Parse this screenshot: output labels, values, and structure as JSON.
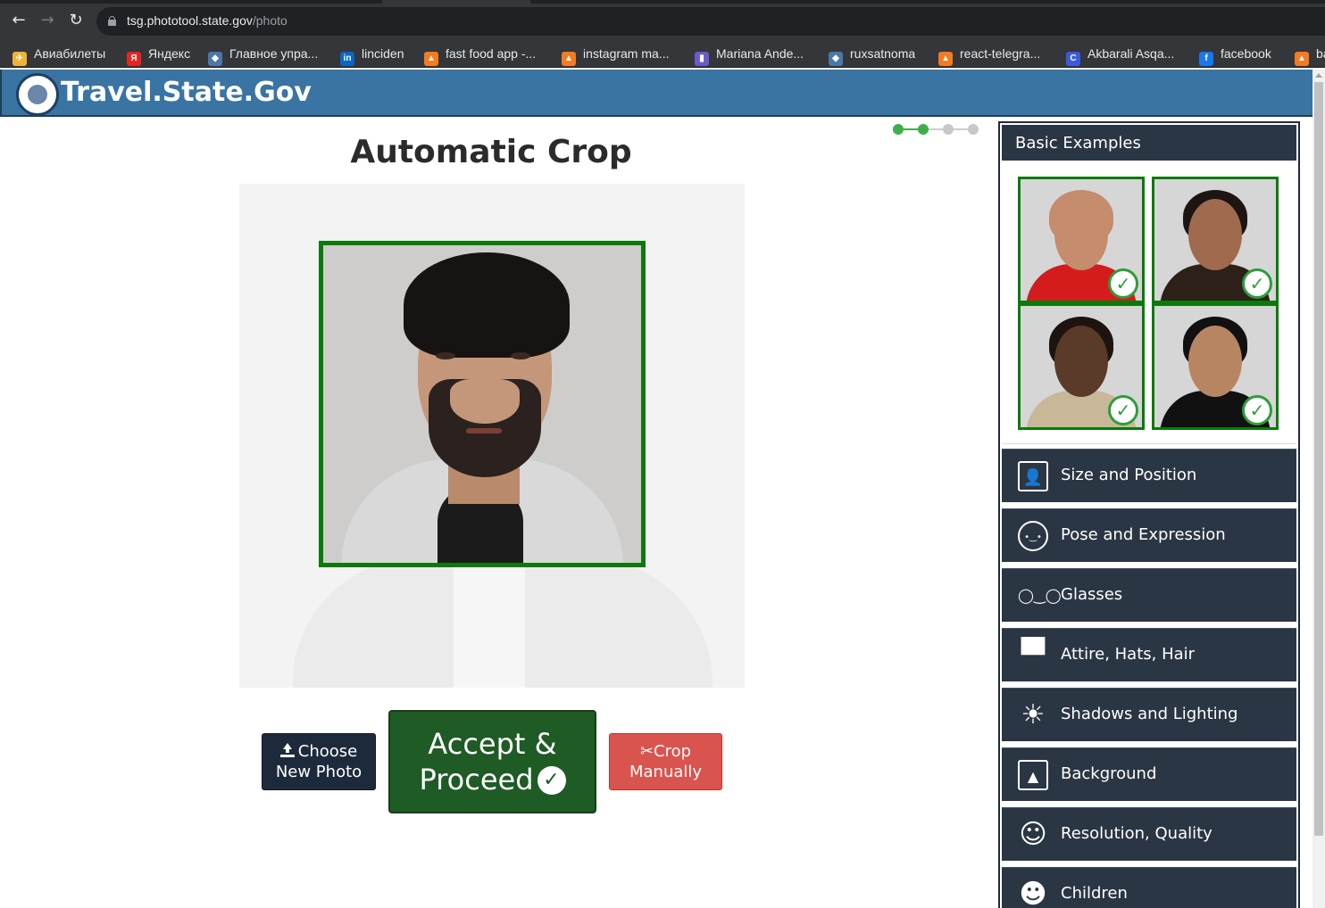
{
  "browser": {
    "url_host": "tsg.phototool.state.gov",
    "url_path": "/photo",
    "bookmarks": [
      {
        "label": "Авиабилеты",
        "color": "#f2b233",
        "glyph": "✈"
      },
      {
        "label": "Яндекс",
        "color": "#e52620",
        "glyph": "Я"
      },
      {
        "label": "Главное упра...",
        "color": "#4a78a8",
        "glyph": "◆"
      },
      {
        "label": "linciden",
        "color": "#0a66c2",
        "glyph": "in"
      },
      {
        "label": "fast food app -...",
        "color": "#f47b20",
        "glyph": "▲"
      },
      {
        "label": "instagram ma...",
        "color": "#f47b20",
        "glyph": "▲"
      },
      {
        "label": "Mariana Ande...",
        "color": "#6a5acd",
        "glyph": "▮"
      },
      {
        "label": "ruxsatnoma",
        "color": "#4a78a8",
        "glyph": "◆"
      },
      {
        "label": "react-telegra...",
        "color": "#f47b20",
        "glyph": "▲"
      },
      {
        "label": "Akbarali Asqa...",
        "color": "#3b5bdb",
        "glyph": "C"
      },
      {
        "label": "facebook",
        "color": "#1877f2",
        "glyph": "f"
      },
      {
        "label": "ba",
        "color": "#f47b20",
        "glyph": "▲"
      }
    ]
  },
  "site": {
    "title": "Travel.State.Gov",
    "logo_icon": "dos-seal-icon"
  },
  "main": {
    "page_title": "Automatic Crop",
    "progress": {
      "total_steps": 4,
      "completed_steps": 2
    },
    "buttons": {
      "choose_line1": "Choose",
      "choose_line2": "New Photo",
      "accept_line1": "Accept &",
      "accept_line2": "Proceed",
      "crop_line1": "Crop",
      "crop_line2": "Manually"
    }
  },
  "sidebar": {
    "header": "Basic Examples",
    "examples": [
      {
        "shirt": "#d41c1c",
        "skin": "#c58c6d",
        "hair": "#c58c6d"
      },
      {
        "shirt": "#2c2019",
        "skin": "#a06a4f",
        "hair": "#1c1512"
      },
      {
        "shirt": "#c9b79a",
        "skin": "#5a3a28",
        "hair": "#1d1410"
      },
      {
        "shirt": "#111111",
        "skin": "#b88563",
        "hair": "#111111"
      }
    ],
    "categories": [
      {
        "label": "Size and Position",
        "icon": "portrait-frame-icon"
      },
      {
        "label": "Pose and Expression",
        "icon": "neutral-face-icon"
      },
      {
        "label": "Glasses",
        "icon": "glasses-icon"
      },
      {
        "label": "Attire, Hats, Hair",
        "icon": "hat-icon"
      },
      {
        "label": "Shadows and Lighting",
        "icon": "sun-icon"
      },
      {
        "label": "Background",
        "icon": "landscape-image-icon"
      },
      {
        "label": "Resolution, Quality",
        "icon": "face-outline-icon"
      },
      {
        "label": "Children",
        "icon": "baby-face-icon"
      }
    ]
  }
}
